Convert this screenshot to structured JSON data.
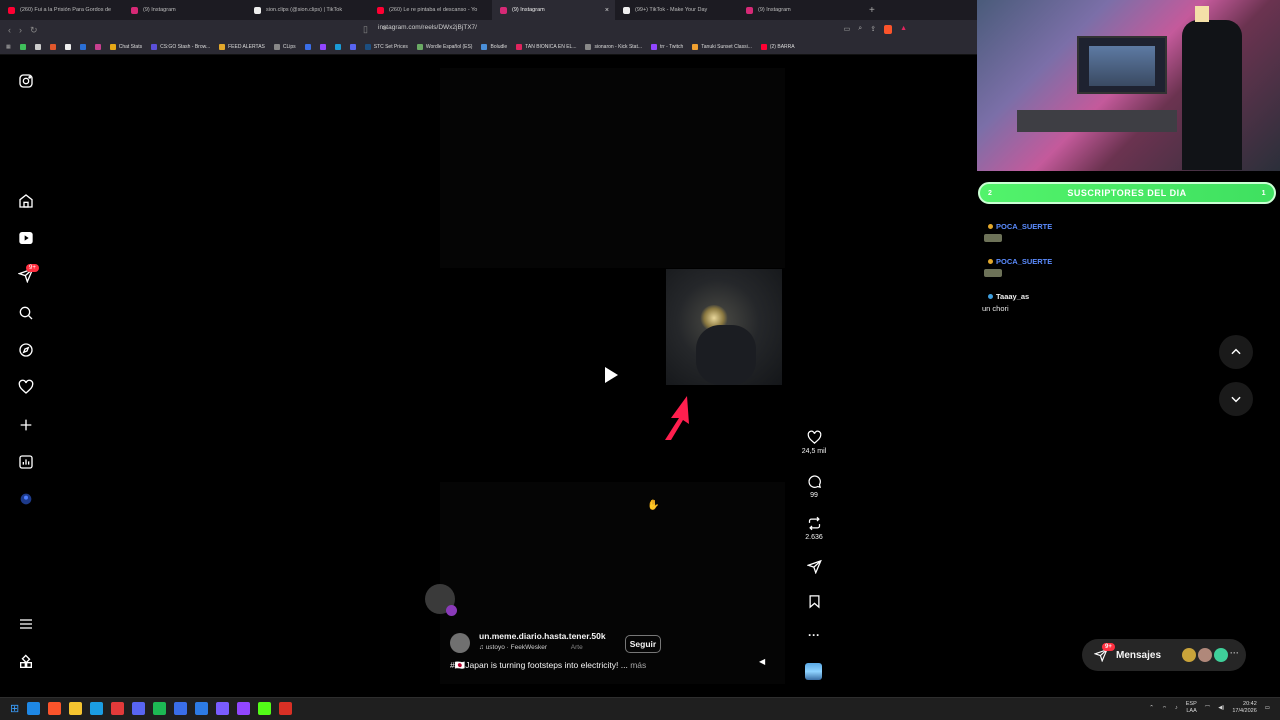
{
  "browser": {
    "tabs": [
      {
        "title": "(260) Fui a la Prisión Para Gordos de",
        "color": "#ff0033"
      },
      {
        "title": "(9) Instagram",
        "color": "#d62976"
      },
      {
        "title": "sion.clips (@sion.clips) | TikTok",
        "color": "#eeeeee"
      },
      {
        "title": "(260) Le re pintaba el descanso - Yo",
        "color": "#ff0033"
      },
      {
        "title": "(9) Instagram",
        "color": "#d62976",
        "active": true
      },
      {
        "title": "(99+) TikTok - Make Your Day",
        "color": "#eeeeee"
      },
      {
        "title": "(9) Instagram",
        "color": "#d62976"
      }
    ],
    "new_tab": "+",
    "close_tab": "×",
    "url": "instagram.com/reels/DWx2jBjTX7/",
    "bookmarks": [
      {
        "label": "",
        "color": "#3fbf5b"
      },
      {
        "label": "",
        "color": "#cccccc"
      },
      {
        "label": "",
        "color": "#e0572c"
      },
      {
        "label": "",
        "color": "#eeeeee"
      },
      {
        "label": "",
        "color": "#2a6fd6"
      },
      {
        "label": "",
        "color": "#c73f8f"
      },
      {
        "label": "Chat Stats",
        "color": "#e6a817"
      },
      {
        "label": "CS:GO Stash - Brow...",
        "color": "#5b4fd9"
      },
      {
        "label": "FEED ALERTAS",
        "color": "#e3a82b"
      },
      {
        "label": "CLips",
        "color": "#888888"
      },
      {
        "label": "",
        "color": "#3a6ee8"
      },
      {
        "label": "",
        "color": "#9146ff"
      },
      {
        "label": "",
        "color": "#1a9bd7"
      },
      {
        "label": "",
        "color": "#5865f2"
      },
      {
        "label": "STC Set Prices",
        "color": "#1c4e80"
      },
      {
        "label": "Wordle Español (ES)",
        "color": "#6aaa64"
      },
      {
        "label": "Boludle",
        "color": "#4a8fd9"
      },
      {
        "label": "TAN BIONICA EN EL...",
        "color": "#e0245e"
      },
      {
        "label": "sionaron - Kick Stat...",
        "color": "#888888"
      },
      {
        "label": "trr - Twitch",
        "color": "#9146ff"
      },
      {
        "label": "Tanuki Sunset Classi...",
        "color": "#f0a030"
      },
      {
        "label": "(2) BARRA",
        "color": "#ff0033"
      }
    ]
  },
  "instagram": {
    "nav_icons": [
      "instagram-logo-icon",
      "home-icon",
      "reels-icon",
      "messages-icon",
      "search-icon",
      "explore-icon",
      "notifications-icon",
      "create-icon",
      "dashboard-icon",
      "profile-icon",
      "menu-icon",
      "more-apps-icon"
    ],
    "messages_badge": "9+",
    "reel": {
      "username": "un.meme.diario.hasta.tener.50k",
      "follow_label": "Seguir",
      "audio": "ustoyo · FeekWesker",
      "audio_extra": "Arte",
      "caption": "#🇯🇵Japan is turning footsteps into electricity! ...",
      "caption_more": "más",
      "likes": "24,5 mil",
      "comments": "99",
      "reposts": "2.636"
    },
    "messages_label": "Mensajes",
    "messages_pill_badge": "9+"
  },
  "stream_overlay": {
    "subs_title": "SUSCRIPTORES DEL DIA",
    "subs_left": "2",
    "subs_right": "1",
    "chat": [
      {
        "user": "POCA_SUERTE",
        "message": "",
        "color": "#5b8cff"
      },
      {
        "user": "POCA_SUERTE",
        "message": "",
        "color": "#5b8cff"
      },
      {
        "user": "Taaay_as",
        "message": "un chori",
        "color": "#eeeeee"
      }
    ]
  },
  "taskbar": {
    "lang": "ESP",
    "lang2": "LAA",
    "time": "20:42",
    "date": "17/4/2026",
    "apps": [
      "#1e88e5",
      "#fb542b",
      "#f4c430",
      "#1b9de2",
      "#e23a3a",
      "#5865f2",
      "#1db954",
      "#3a6ee8",
      "#2d7be5",
      "#7a5cff",
      "#9146ff",
      "#53fc18",
      "#d93025"
    ]
  }
}
